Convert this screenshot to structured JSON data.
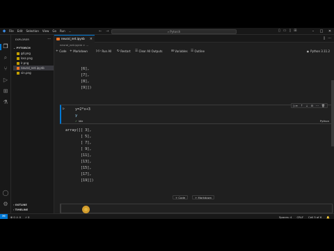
{
  "menu": [
    "File",
    "Edit",
    "Selection",
    "View",
    "Go",
    "Run",
    "..."
  ],
  "search": {
    "text": "Pytorch"
  },
  "sidebar": {
    "title": "EXPLORER",
    "folder": "PYTORCH",
    "files": [
      {
        "name": "gd.png",
        "color": "#c4a000"
      },
      {
        "name": "loss.png",
        "color": "#c4a000"
      },
      {
        "name": "lr.png",
        "color": "#c4a000"
      },
      {
        "name": "neural_net.ipynb",
        "color": "#f37726"
      },
      {
        "name": "sin.png",
        "color": "#c4a000"
      }
    ],
    "outline": "OUTLINE",
    "timeline": "TIMELINE"
  },
  "tab": {
    "label": "neural_net.ipynb"
  },
  "breadcrumb": "neural_net.ipynb > ...",
  "toolbar": {
    "code": "Code",
    "markdown": "Markdown",
    "run_all": "Run All",
    "restart": "Restart",
    "clear_outputs": "Clear All Outputs",
    "variables": "Variables",
    "outline": "Outline",
    "kernel": "Python 3.11.2"
  },
  "prev_output": [
    "[6],",
    "[7],",
    "[8],",
    "[9]])"
  ],
  "cell": {
    "lines": [
      "y=2*x+3",
      "y"
    ],
    "idle": "Idle",
    "lang": "Python"
  },
  "output": [
    "array([[ 3],",
    "       [ 5],",
    "       [ 7],",
    "       [ 9],",
    "       [11],",
    "       [13],",
    "       [15],",
    "       [17],",
    "       [19]])"
  ],
  "add": {
    "code": "+ Code",
    "markdown": "+ Markdown"
  },
  "empty_cell_lang": "Python",
  "status": {
    "errors": "0",
    "warnings": "0",
    "spaces": "Spaces: 4",
    "eol": "CRLF",
    "cell": "Cell 5 of 6"
  },
  "colors": {
    "accent": "#0078d4",
    "cursor": "#e6a92e"
  }
}
